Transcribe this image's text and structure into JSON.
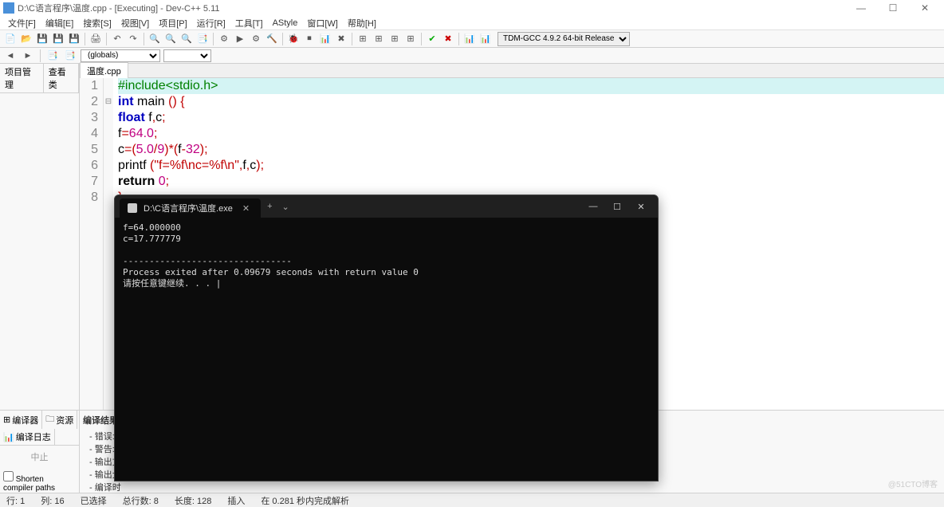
{
  "title": "D:\\C语言程序\\温度.cpp - [Executing] - Dev-C++ 5.11",
  "menu": [
    "文件[F]",
    "编辑[E]",
    "搜索[S]",
    "视图[V]",
    "项目[P]",
    "运行[R]",
    "工具[T]",
    "AStyle",
    "窗口[W]",
    "帮助[H]"
  ],
  "compiler_selector": "TDM-GCC 4.9.2 64-bit Release",
  "globals_selector": "(globals)",
  "sidebar_tabs": [
    "项目管理",
    "查看类"
  ],
  "file_tab": "温度.cpp",
  "code_lines": [
    {
      "n": 1,
      "hl": true,
      "html": "<span class='kw-pre'>#include&lt;stdio.h&gt;</span>"
    },
    {
      "n": 2,
      "fold": "⊟",
      "html": "<span class='kw-blue'>int</span> <span class='id'>main</span> <span class='punc'>()</span> <span class='brace'>{</span>"
    },
    {
      "n": 3,
      "html": "    <span class='kw-blue'>float</span> <span class='id'>f</span><span class='punc'>,</span><span class='id'>c</span><span class='punc'>;</span>"
    },
    {
      "n": 4,
      "html": "  <span class='id'>f</span><span class='punc'>=</span><span class='num'>64.0</span><span class='punc'>;</span>"
    },
    {
      "n": 5,
      "html": "  <span class='id'>c</span><span class='punc'>=(</span><span class='num'>5.0</span><span class='punc'>/</span><span class='num'>9</span><span class='punc'>)*(</span><span class='id'>f</span><span class='punc'>-</span><span class='num'>32</span><span class='punc'>);</span>"
    },
    {
      "n": 6,
      "html": "  <span class='id'>printf</span> <span class='punc'>(</span><span class='str'>\"f=%f\\nc=%f\\n\"</span><span class='punc'>,</span><span class='id'>f</span><span class='punc'>,</span><span class='id'>c</span><span class='punc'>);</span>"
    },
    {
      "n": 7,
      "html": "  <span class='kw-black'>return</span> <span class='num'>0</span><span class='punc'>;</span>"
    },
    {
      "n": 8,
      "html": "<span class='brace'>}</span>"
    }
  ],
  "bottom_tabs": [
    {
      "icon": "⊞",
      "label": "编译器"
    },
    {
      "icon": "🗀",
      "label": "资源"
    },
    {
      "icon": "📊",
      "label": "编译日志"
    }
  ],
  "stop_label": "中止",
  "shorten_label": "Shorten compiler paths",
  "compile_results": {
    "header": "编译结果",
    "lines": [
      "- 错误:",
      "- 警告:",
      "- 输出文",
      "- 输出大",
      "- 编译时"
    ]
  },
  "status": {
    "line_lbl": "行:",
    "line": "1",
    "col_lbl": "列:",
    "col": "16",
    "sel_lbl": "已选择",
    "sel": "",
    "total_lbl": "总行数:",
    "total": "8",
    "len_lbl": "长度:",
    "len": "128",
    "mode": "插入",
    "parse": "在 0.281 秒内完成解析"
  },
  "console": {
    "tab_title": "D:\\C语言程序\\温度.exe",
    "output": "f=64.000000\nc=17.777779\n\n--------------------------------\nProcess exited after 0.09679 seconds with return value 0\n请按任意键继续. . . |"
  },
  "watermark": "@51CTO博客"
}
